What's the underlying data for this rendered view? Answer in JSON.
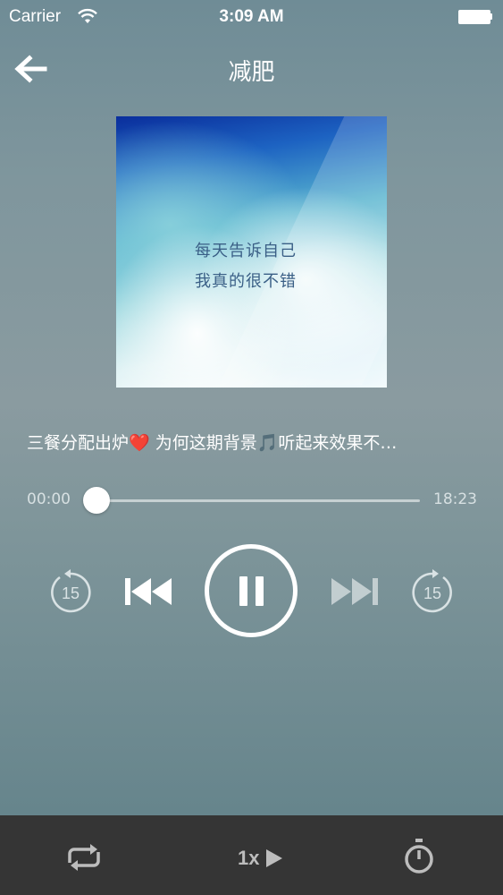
{
  "status_bar": {
    "carrier": "Carrier",
    "time": "3:09 AM"
  },
  "nav": {
    "title": "减肥"
  },
  "album_art": {
    "line1": "每天告诉自己",
    "line2": "我真的很不错"
  },
  "episode": {
    "title": "三餐分配出炉❤️ 为何这期背景🎵听起来效果不…"
  },
  "progress": {
    "current": "00:00",
    "total": "18:23",
    "fraction": 0
  },
  "controls": {
    "rewind_seconds": "15",
    "forward_seconds": "15",
    "state": "playing"
  },
  "bottom_bar": {
    "speed": "1x"
  },
  "colors": {
    "background_top": "#6f8c96",
    "bottom_bar": "#353535",
    "accent": "#ffffff"
  }
}
